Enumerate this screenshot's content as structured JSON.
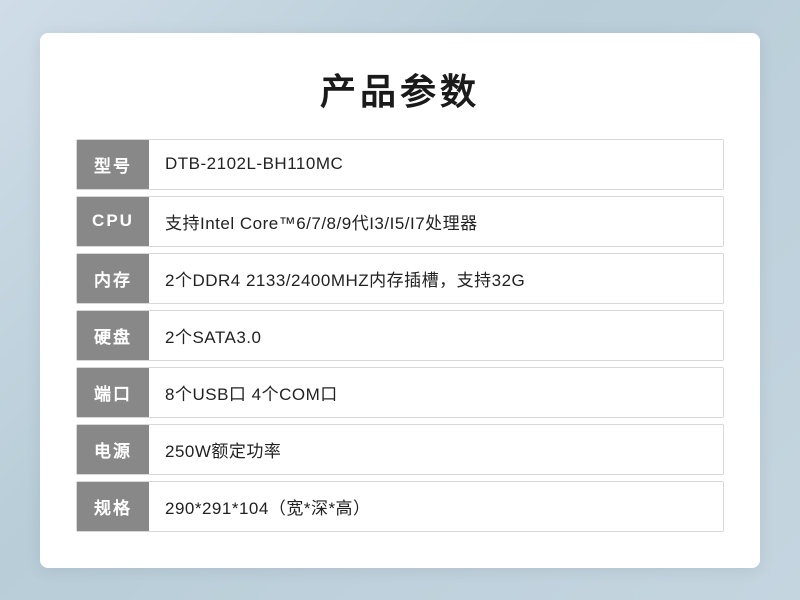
{
  "page": {
    "title": "产品参数",
    "rows": [
      {
        "label": "型号",
        "value": "DTB-2102L-BH110MC"
      },
      {
        "label": "CPU",
        "value": "支持Intel Core™6/7/8/9代I3/I5/I7处理器"
      },
      {
        "label": "内存",
        "value": "2个DDR4 2133/2400MHZ内存插槽，支持32G"
      },
      {
        "label": "硬盘",
        "value": "2个SATA3.0"
      },
      {
        "label": "端口",
        "value": "8个USB口 4个COM口"
      },
      {
        "label": "电源",
        "value": "250W额定功率"
      },
      {
        "label": "规格",
        "value": "290*291*104（宽*深*高）"
      }
    ]
  }
}
